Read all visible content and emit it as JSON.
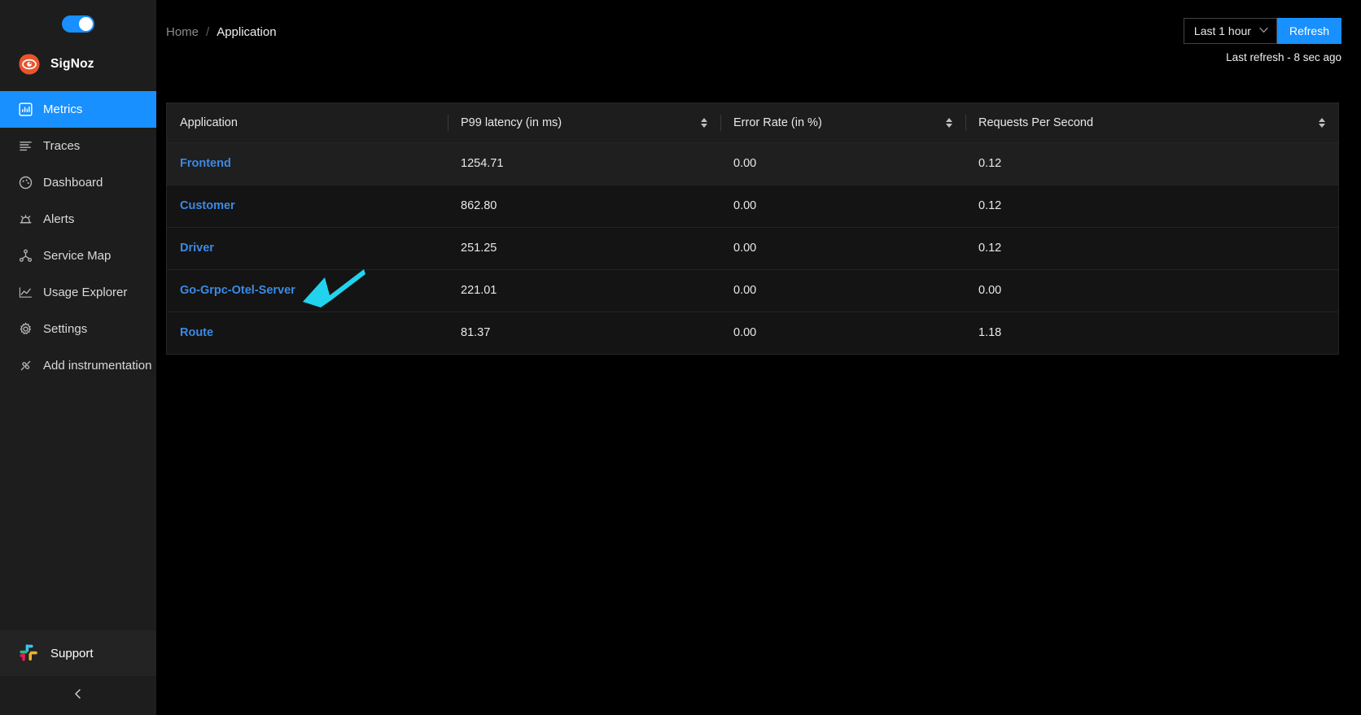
{
  "sidebar": {
    "theme_toggle": {
      "name": "dark-mode-toggle",
      "state": "on"
    },
    "brand": {
      "label": "SigNoz",
      "logo_color": "#e8552d"
    },
    "items": [
      {
        "label": "Metrics",
        "icon": "bar-chart-icon",
        "active": true
      },
      {
        "label": "Traces",
        "icon": "list-lines-icon",
        "active": false
      },
      {
        "label": "Dashboard",
        "icon": "dashboard-gauge-icon",
        "active": false
      },
      {
        "label": "Alerts",
        "icon": "alarm-bell-icon",
        "active": false
      },
      {
        "label": "Service Map",
        "icon": "node-graph-icon",
        "active": false
      },
      {
        "label": "Usage Explorer",
        "icon": "line-chart-icon",
        "active": false
      },
      {
        "label": "Settings",
        "icon": "gear-icon",
        "active": false
      },
      {
        "label": "Add instrumentation",
        "icon": "plug-connect-icon",
        "active": false
      }
    ],
    "support": {
      "label": "Support",
      "icon": "slack-icon"
    },
    "collapse": {
      "icon": "chevron-left-icon"
    }
  },
  "header": {
    "breadcrumb": {
      "home": "Home",
      "separator": "/",
      "current": "Application"
    },
    "time_range": {
      "value": "Last 1 hour",
      "chevron": "∨"
    },
    "refresh_button": "Refresh",
    "last_refresh": "Last refresh - 8 sec ago",
    "accent_color": "#1890ff"
  },
  "table": {
    "columns": [
      {
        "label": "Application",
        "sortable": false
      },
      {
        "label": "P99 latency (in ms)",
        "sortable": true
      },
      {
        "label": "Error Rate (in %)",
        "sortable": true
      },
      {
        "label": "Requests Per Second",
        "sortable": true
      }
    ],
    "rows": [
      {
        "application": "Frontend",
        "p99": "1254.71",
        "error_rate": "0.00",
        "rps": "0.12",
        "hover": true
      },
      {
        "application": "Customer",
        "p99": "862.80",
        "error_rate": "0.00",
        "rps": "0.12",
        "hover": false
      },
      {
        "application": "Driver",
        "p99": "251.25",
        "error_rate": "0.00",
        "rps": "0.12",
        "hover": false
      },
      {
        "application": "Go-Grpc-Otel-Server",
        "p99": "221.01",
        "error_rate": "0.00",
        "rps": "0.00",
        "hover": false
      },
      {
        "application": "Route",
        "p99": "81.37",
        "error_rate": "0.00",
        "rps": "1.18",
        "hover": false
      }
    ],
    "link_color": "#3b8ae5"
  },
  "annotation": {
    "type": "arrow",
    "color": "#22d3ee",
    "points_at": "Go-Grpc-Otel-Server"
  }
}
